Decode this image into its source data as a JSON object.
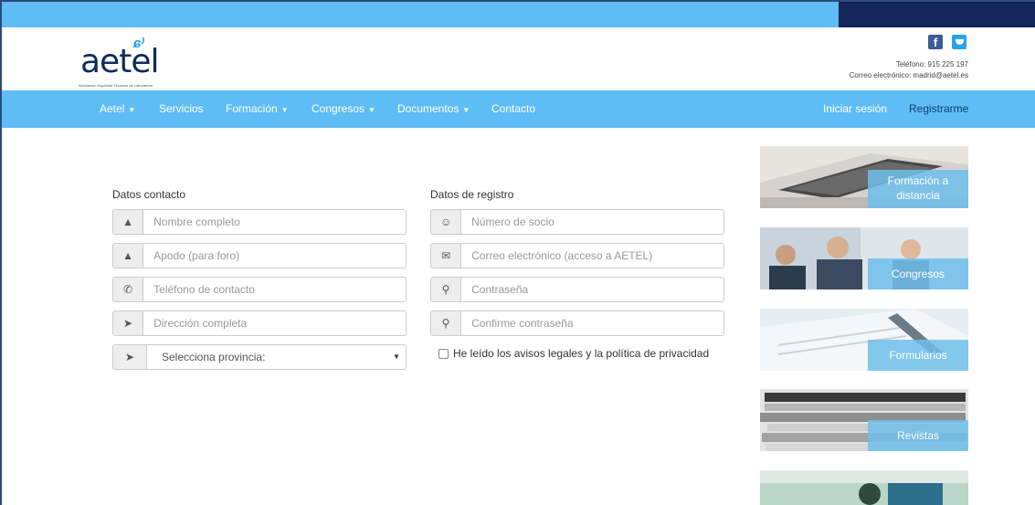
{
  "header": {
    "logo_text": "aetel",
    "logo_tagline": "Asociación Española Técnicos de Laboratorio",
    "phone": "Teléfono: 915 225 197",
    "email": "Correo electrónico: madrid@aetel.es"
  },
  "nav": {
    "items": [
      {
        "label": "Aetel",
        "caret": "▼"
      },
      {
        "label": "Servicios",
        "caret": ""
      },
      {
        "label": "Formación",
        "caret": "▼"
      },
      {
        "label": "Congresos",
        "caret": "▼"
      },
      {
        "label": "Documentos",
        "caret": "▼"
      },
      {
        "label": "Contacto",
        "caret": ""
      }
    ],
    "login": "Iniciar sesión",
    "register": "Registrarme"
  },
  "contact_form": {
    "title": "Datos contacto",
    "fields": [
      {
        "placeholder": "Nombre completo",
        "icon": "user-icon"
      },
      {
        "placeholder": "Apodo (para foro)",
        "icon": "user-icon"
      },
      {
        "placeholder": "Teléfono de contacto",
        "icon": "phone-icon"
      },
      {
        "placeholder": "Dirección completa",
        "icon": "location-arrow-icon"
      }
    ],
    "province_select": {
      "value": "Selecciona provincia:",
      "icon": "location-arrow-icon"
    }
  },
  "registration_form": {
    "title": "Datos de registro",
    "fields": [
      {
        "placeholder": "Número de socio",
        "icon": "user-circle-icon"
      },
      {
        "placeholder": "Correo electrónico (acceso a AETEL)",
        "icon": "envelope-icon"
      },
      {
        "placeholder": "Contraseña",
        "icon": "key-icon"
      },
      {
        "placeholder": "Confirme contraseña",
        "icon": "key-icon"
      }
    ],
    "terms_label": "He leído los avisos legales y la política de privacidad"
  },
  "tiles": [
    {
      "caption_line1": "Formación a",
      "caption_line2": "distancia"
    },
    {
      "caption_line1": "Congresos",
      "caption_line2": ""
    },
    {
      "caption_line1": "Formularios",
      "caption_line2": ""
    },
    {
      "caption_line1": "Revistas",
      "caption_line2": ""
    },
    {
      "caption_line1": "",
      "caption_line2": ""
    }
  ],
  "colors": {
    "nav_bg": "#5fbdf5",
    "top_dark": "#14255a",
    "logo": "#0d2c5e",
    "register_link": "#113e70"
  }
}
